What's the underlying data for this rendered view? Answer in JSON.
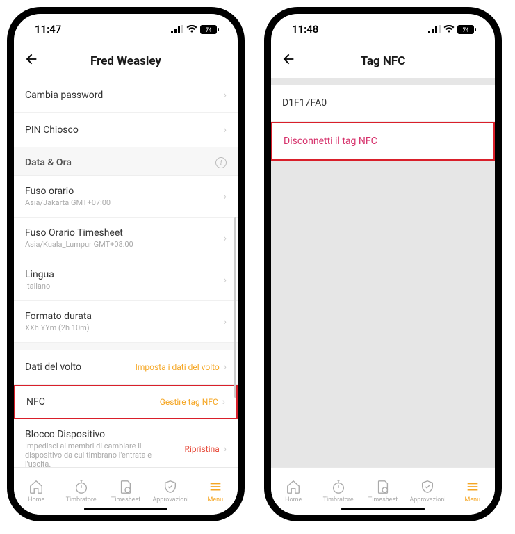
{
  "left": {
    "time": "11:47",
    "battery": "74",
    "title": "Fred Weasley",
    "items": {
      "change_password": "Cambia password",
      "pin_kiosk": "PIN Chiosco",
      "data_ora": "Data & Ora",
      "fuso": {
        "label": "Fuso orario",
        "sub": "Asia/Jakarta GMT+07:00"
      },
      "fuso_ts": {
        "label": "Fuso Orario Timesheet",
        "sub": "Asia/Kuala_Lumpur GMT+08:00"
      },
      "lingua": {
        "label": "Lingua",
        "sub": "Italiano"
      },
      "durata": {
        "label": "Formato durata",
        "sub": "XXh YYm (2h 10m)"
      },
      "volto": {
        "label": "Dati del volto",
        "action": "Imposta i dati del volto"
      },
      "nfc": {
        "label": "NFC",
        "action": "Gestire tag NFC"
      },
      "blocco": {
        "label": "Blocco Dispositivo",
        "sub": "Impedisci ai membri di cambiare il dispositivo da cui timbrano l'entrata e l'uscita.",
        "action": "Ripristina"
      }
    }
  },
  "right": {
    "time": "11:48",
    "battery": "74",
    "title": "Tag NFC",
    "nfc_id": "D1F17FA0",
    "disconnect": "Disconnetti il tag NFC"
  },
  "tabs": {
    "home": "Home",
    "timbratore": "Timbratore",
    "timesheet": "Timesheet",
    "approvazioni": "Approvazioni",
    "menu": "Menu"
  }
}
